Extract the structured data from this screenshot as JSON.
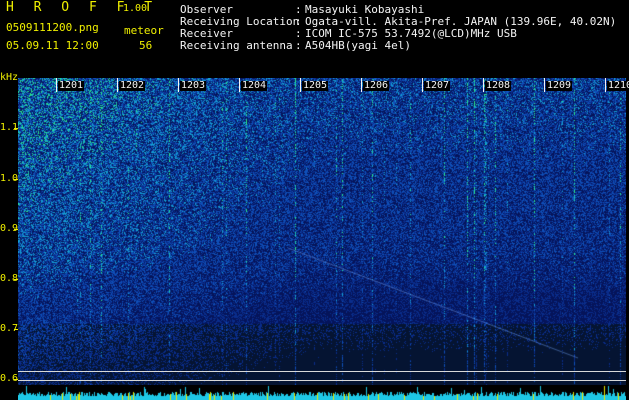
{
  "header": {
    "app_title": "H R O F F T",
    "app_version": "1.00",
    "file_name": "0509111200.png",
    "meteor_label": "meteor",
    "date_time": "05.09.11 12:00",
    "meteor_count": "56"
  },
  "info": [
    {
      "label": "Observer",
      "value": "Masayuki Kobayashi"
    },
    {
      "label": "Receiving Location",
      "value": "Ogata-vill. Akita-Pref. JAPAN (139.96E, 40.02N)"
    },
    {
      "label": "Receiver",
      "value": "ICOM IC-575 53.7492(@LCD)MHz USB"
    },
    {
      "label": "Receiving antenna",
      "value": "A504HB(yagi 4el)"
    }
  ],
  "axis": {
    "y_unit": "kHz",
    "y_ticks": [
      "1.1",
      "1.0",
      "0.9",
      "0.8",
      "0.7",
      "0.6"
    ],
    "x_ticks": [
      "1201",
      "1202",
      "1203",
      "1204",
      "1205",
      "1206",
      "1207",
      "1208",
      "1209",
      "1210"
    ]
  },
  "colors": {
    "background": "#000000",
    "header_yellow": "#f0f000",
    "header_white": "#f4f4f4",
    "spectrogram_base": "#0a2a6e"
  }
}
